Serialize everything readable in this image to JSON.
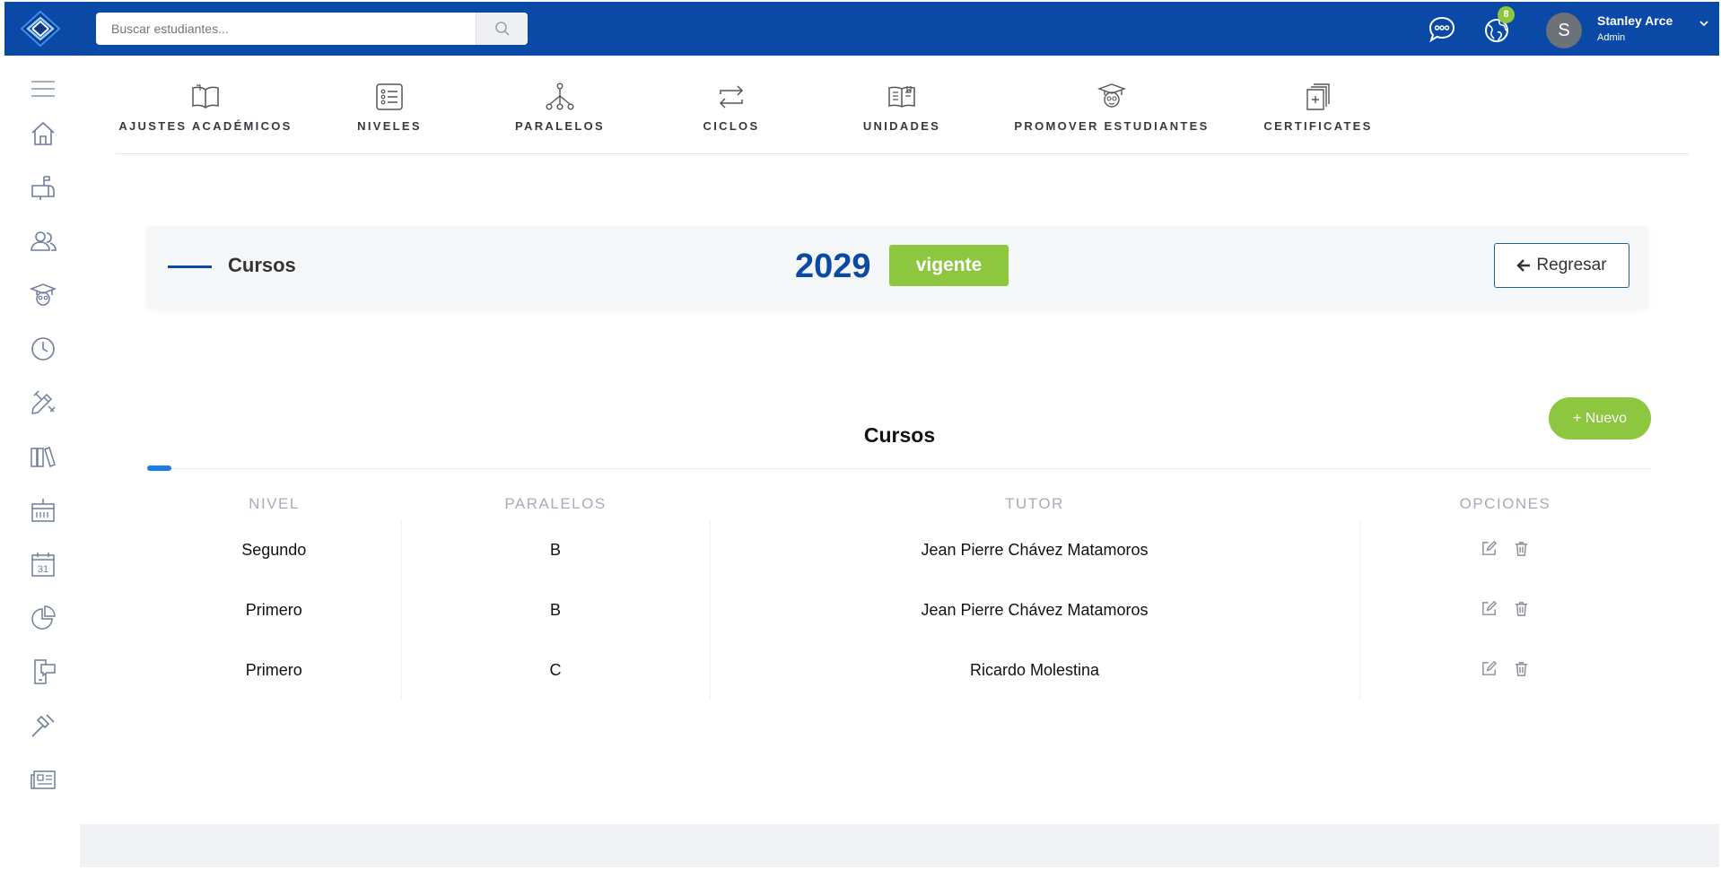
{
  "header": {
    "search": {
      "placeholder": "Buscar estudiantes..."
    },
    "notifications_count": "8",
    "user": {
      "initial": "S",
      "name": "Stanley Arce",
      "role": "Admin"
    }
  },
  "sidebar": {
    "items": [
      {
        "icon": "menu-icon"
      },
      {
        "icon": "home-icon"
      },
      {
        "icon": "mailbox-icon"
      },
      {
        "icon": "users-icon"
      },
      {
        "icon": "graduate-icon"
      },
      {
        "icon": "clock-icon"
      },
      {
        "icon": "pencil-ruler-icon"
      },
      {
        "icon": "books-icon"
      },
      {
        "icon": "register-icon"
      },
      {
        "icon": "calendar-icon",
        "text": "31"
      },
      {
        "icon": "pie-chart-icon"
      },
      {
        "icon": "mobile-chat-icon"
      },
      {
        "icon": "gavel-icon"
      },
      {
        "icon": "newspaper-icon"
      }
    ]
  },
  "tabs": [
    {
      "label": "AJUSTES ACADÉMICOS",
      "icon": "book-open-icon"
    },
    {
      "label": "NIVELES",
      "icon": "list-icon"
    },
    {
      "label": "PARALELOS",
      "icon": "hierarchy-icon"
    },
    {
      "label": "CICLOS",
      "icon": "cycle-icon"
    },
    {
      "label": "UNIDADES",
      "icon": "book-units-icon"
    },
    {
      "label": "PROMOVER ESTUDIANTES",
      "icon": "graduate-cap-icon"
    },
    {
      "label": "CERTIFICATES",
      "icon": "certificates-icon"
    }
  ],
  "page_header": {
    "title": "Cursos",
    "year": "2029",
    "status": "vigente",
    "back_label": "Regresar"
  },
  "courses": {
    "title": "Cursos",
    "new_label": "+ Nuevo",
    "columns": [
      "NIVEL",
      "PARALELOS",
      "TUTOR",
      "OPCIONES"
    ],
    "rows": [
      {
        "nivel": "Segundo",
        "paralelo": "B",
        "tutor": "Jean Pierre Chávez Matamoros"
      },
      {
        "nivel": "Primero",
        "paralelo": "B",
        "tutor": "Jean Pierre Chávez Matamoros"
      },
      {
        "nivel": "Primero",
        "paralelo": "C",
        "tutor": "Ricardo Molestina"
      }
    ]
  },
  "colors": {
    "brand_blue": "#0a4aa6",
    "accent_green": "#8dc63f",
    "accent_line": "#1e7be6"
  }
}
